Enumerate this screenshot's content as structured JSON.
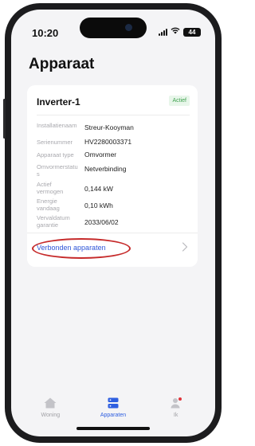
{
  "status_bar": {
    "time": "10:20",
    "battery": "44"
  },
  "page": {
    "title": "Apparaat"
  },
  "device_card": {
    "name": "Inverter-1",
    "status": "Actief",
    "status_color": "#3fa14f",
    "rows": [
      {
        "label": "Installatienaam",
        "value": "Streur-Kooyman"
      },
      {
        "label": "Serienummer",
        "value": "HV2280003371"
      },
      {
        "label": "Apparaat type",
        "value": "Omvormer"
      },
      {
        "label": "Omvormerstatus",
        "value": "Netverbinding"
      },
      {
        "label": "Actief vermogen",
        "value": "0,144 kW"
      },
      {
        "label": "Energie vandaag",
        "value": "0,10 kWh"
      },
      {
        "label": "Vervaldatum garantie",
        "value": "2033/06/02"
      }
    ],
    "connected_devices_label": "Verbonden apparaten",
    "link_color": "#2f56d8"
  },
  "tab_bar": {
    "tabs": [
      {
        "label": "Woning",
        "icon": "house-icon",
        "active": false
      },
      {
        "label": "Apparaten",
        "icon": "devices-icon",
        "active": true
      },
      {
        "label": "Ik",
        "icon": "person-icon",
        "active": false
      }
    ],
    "active_color": "#2f5fe0",
    "notification_dot_color": "#e0343a"
  }
}
